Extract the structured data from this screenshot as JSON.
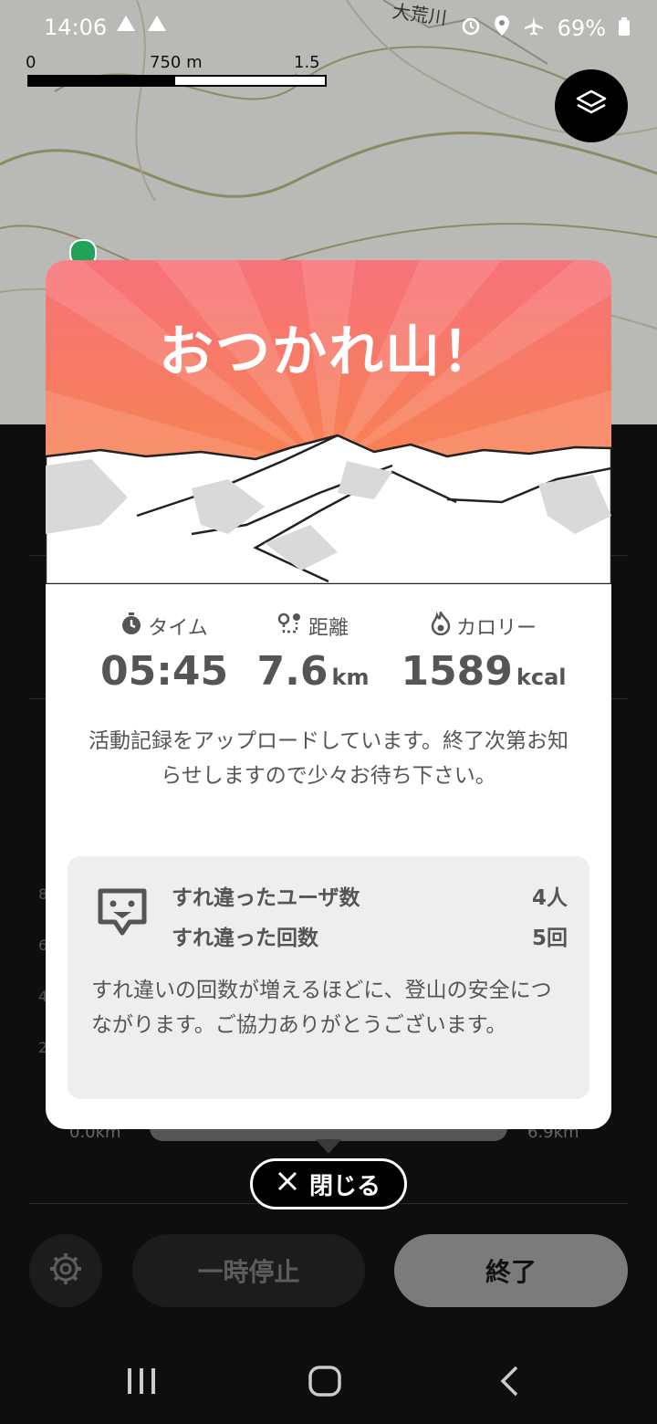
{
  "status_bar": {
    "time": "14:06",
    "battery": "69%"
  },
  "map": {
    "scale_labels": [
      "0",
      "750 m",
      "1.5 km"
    ],
    "place_label": "大荒川"
  },
  "modal": {
    "title": "おつかれ山！",
    "stats": [
      {
        "label": "タイム",
        "value": "05:45",
        "unit": "",
        "icon": "stopwatch-icon"
      },
      {
        "label": "距離",
        "value": "7.6",
        "unit": "km",
        "icon": "route-icon"
      },
      {
        "label": "カロリー",
        "value": "1589",
        "unit": "kcal",
        "icon": "flame-icon"
      }
    ],
    "upload_message": "活動記録をアップロードしています。終了次第お知らせしますので少々お待ち下さい。",
    "passing": {
      "users_label": "すれ違ったユーザ数",
      "users_value": "4人",
      "count_label": "すれ違った回数",
      "count_value": "5回",
      "note": "すれ違いの回数が増えるほどに、登山の安全につながります。ご協力ありがとうございます。"
    }
  },
  "close_button": {
    "label": "閉じる"
  },
  "controls": {
    "pause_label": "一時停止",
    "finish_label": "終了"
  },
  "background_chart": {
    "y_ticks": [
      "8",
      "6",
      "4",
      "2"
    ],
    "range_start": "0.0km",
    "range_end": "6.9km"
  },
  "colors": {
    "hero_top": "#f7727a",
    "hero_bottom": "#f7843c",
    "finish_button": "#7b7b7b"
  }
}
